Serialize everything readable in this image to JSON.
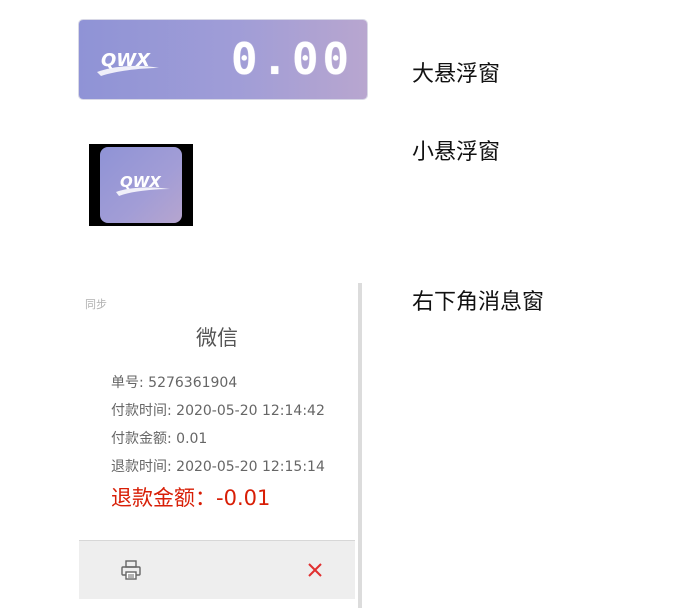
{
  "big_float": {
    "logo_text": "QWX",
    "amount": "0.00",
    "label": "大悬浮窗"
  },
  "small_float": {
    "logo_text": "QWX",
    "label": "小悬浮窗"
  },
  "notification": {
    "label": "右下角消息窗",
    "sync": "同步",
    "title": "微信",
    "order_no": "单号: 5276361904",
    "pay_time": "付款时间: 2020-05-20 12:14:42",
    "pay_amount": "付款金额: 0.01",
    "refund_time": "退款时间: 2020-05-20 12:15:14",
    "refund_amount": "退款金额：-0.01",
    "print_icon": "printer-icon",
    "close_icon": "close-icon"
  },
  "colors": {
    "gradient_start": "#8f93d6",
    "gradient_end": "#b8a6cf",
    "refund_red": "#d81e06",
    "close_red": "#e03030"
  }
}
